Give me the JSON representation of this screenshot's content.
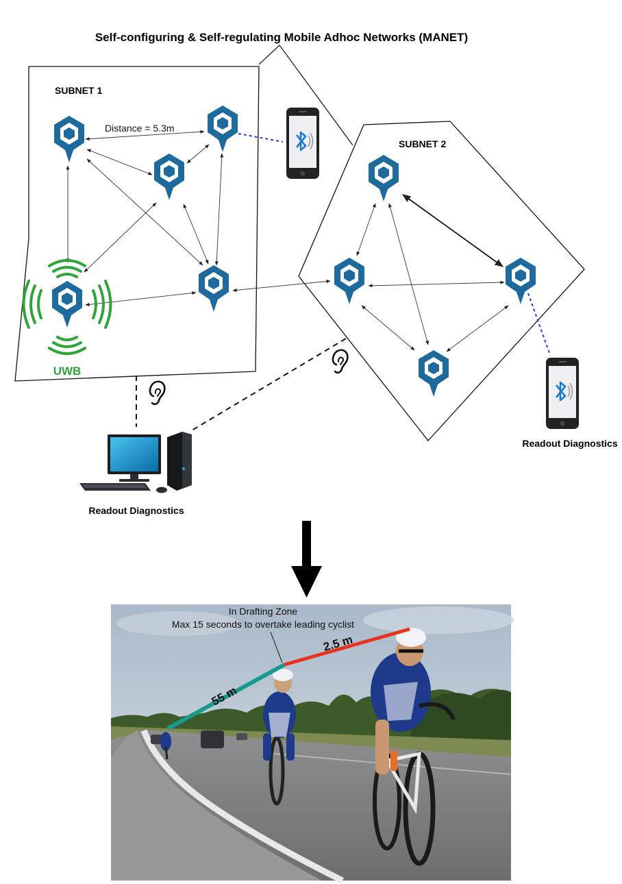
{
  "title": "Self-configuring & Self-regulating Mobile Adhoc Networks (MANET)",
  "subnet1": {
    "label": "SUBNET 1",
    "distance_label": "Distance = 5.3m",
    "uwb_label": "UWB"
  },
  "subnet2": {
    "label": "SUBNET 2"
  },
  "readout": {
    "pc_label": "Readout Diagnostics",
    "phone_label": "Readout Diagnostics"
  },
  "photo": {
    "zone_line1": "In Drafting Zone",
    "zone_line2": "Max 15 seconds to overtake leading cyclist",
    "distance_far": "55 m",
    "distance_near": "2.5 m"
  },
  "colors": {
    "node": "#1f6a9c",
    "uwb": "#2ea43a",
    "bluetooth_link": "#1f3fd0",
    "teal_line": "#1a9a8c",
    "red_line": "#e8321e"
  },
  "icons": [
    "hexagon-node-icon",
    "bluetooth-icon",
    "ear-icon",
    "desktop-computer-icon",
    "smartphone-icon",
    "down-arrow-icon",
    "uwb-signal-icon"
  ]
}
